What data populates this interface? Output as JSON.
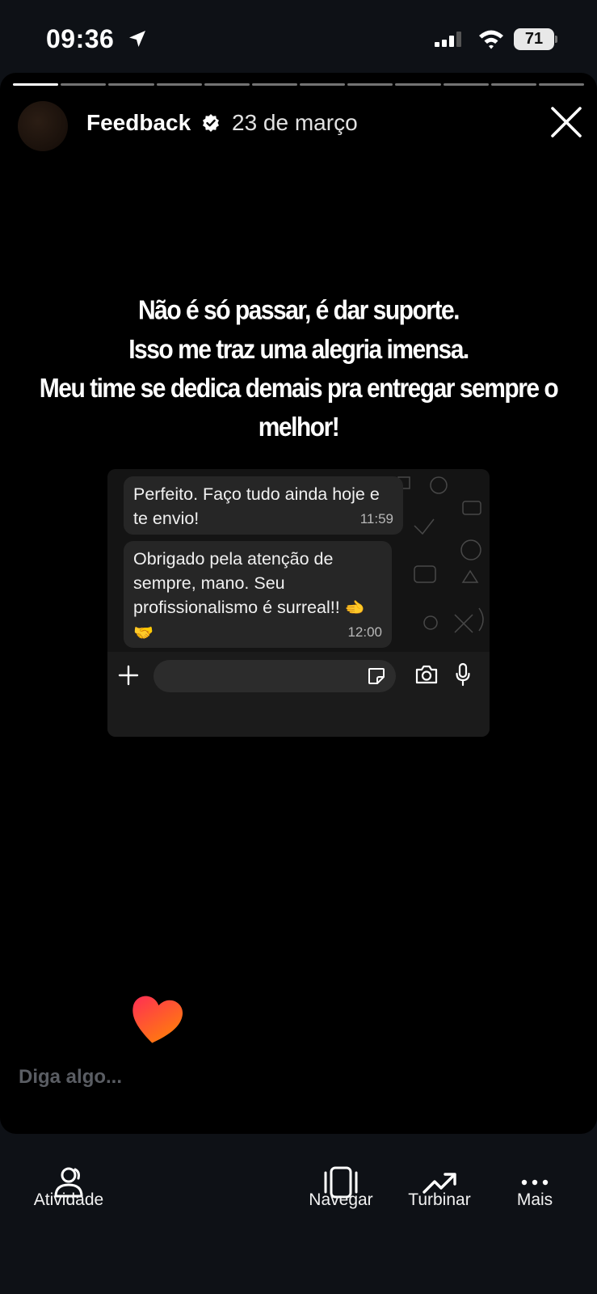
{
  "status_bar": {
    "time": "09:36",
    "battery": "71"
  },
  "story": {
    "progress": {
      "total_segments": 12,
      "completed_segments": 1
    },
    "account_name": "Feedback",
    "date": "23 de março",
    "caption_lines": [
      "Não é só passar, é dar suporte.",
      "Isso me traz uma alegria imensa.",
      "Meu time se dedica demais pra entregar sempre o melhor!"
    ],
    "chat": {
      "messages": [
        {
          "text": "Perfeito. Faço tudo ainda hoje e te envio!",
          "time": "11:59"
        },
        {
          "text": "Obrigado pela atenção de sempre, mano. Seu profissionalismo é surreal!! ",
          "emoji": "🫲🤝",
          "time": "12:00"
        }
      ]
    },
    "reply_placeholder": "Diga algo..."
  },
  "bottom_bar": {
    "activity": "Atividade",
    "browse": "Navegar",
    "boost": "Turbinar",
    "more": "Mais"
  },
  "colors": {
    "background": "#000000",
    "bar": "#0e1116",
    "bubble": "#262626",
    "heart_start": "#ff2d55",
    "heart_end": "#ff8a00"
  },
  "icons": [
    "location-arrow-icon",
    "signal-icon",
    "wifi-icon",
    "verified-badge-icon",
    "close-icon",
    "plus-icon",
    "sticker-icon",
    "camera-icon",
    "mic-icon",
    "heart-icon",
    "activity-icon",
    "browse-icon",
    "boost-icon",
    "more-icon"
  ]
}
